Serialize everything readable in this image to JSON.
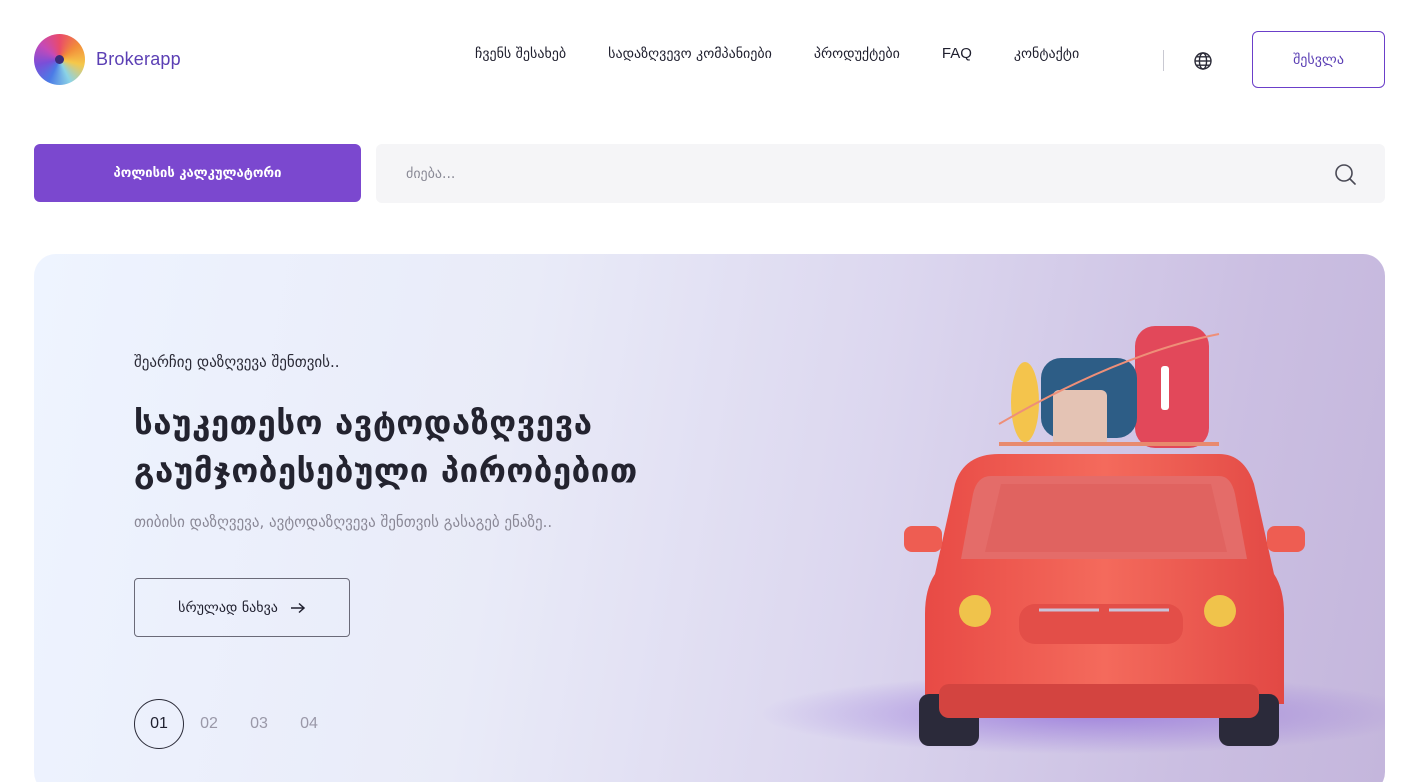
{
  "brand": {
    "name": "Brokerapp"
  },
  "nav": {
    "items": [
      {
        "label": "ჩვენს შესახებ"
      },
      {
        "label": "სადაზღვევო კომპანიები"
      },
      {
        "label": "პროდუქტები"
      },
      {
        "label": "FAQ"
      },
      {
        "label": "კონტაქტი"
      }
    ],
    "language_icon": "globe-icon",
    "login_label": "შესვლა"
  },
  "toolbar": {
    "calculator_label": "პოლისის კალკულატორი",
    "search_placeholder": "ძიება...",
    "search_icon": "search-icon"
  },
  "hero": {
    "kicker": "შეარჩიე დაზღვევა შენთვის..",
    "title_line1": "საუკეთესო ავტოდაზღვევა",
    "title_line2": "გაუმჯობესებული პირობებით",
    "subtitle": "თიბისი დაზღვევა, ავტოდაზღვევა შენთვის გასაგებ ენაზე..",
    "cta_label": "სრულად ნახვა",
    "cta_icon": "arrow-right-icon",
    "pages": [
      "01",
      "02",
      "03",
      "04"
    ],
    "active_page": "01"
  },
  "colors": {
    "accent": "#7b48cf",
    "brand_text": "#5b3fb4",
    "car_body": "#f0594f"
  }
}
